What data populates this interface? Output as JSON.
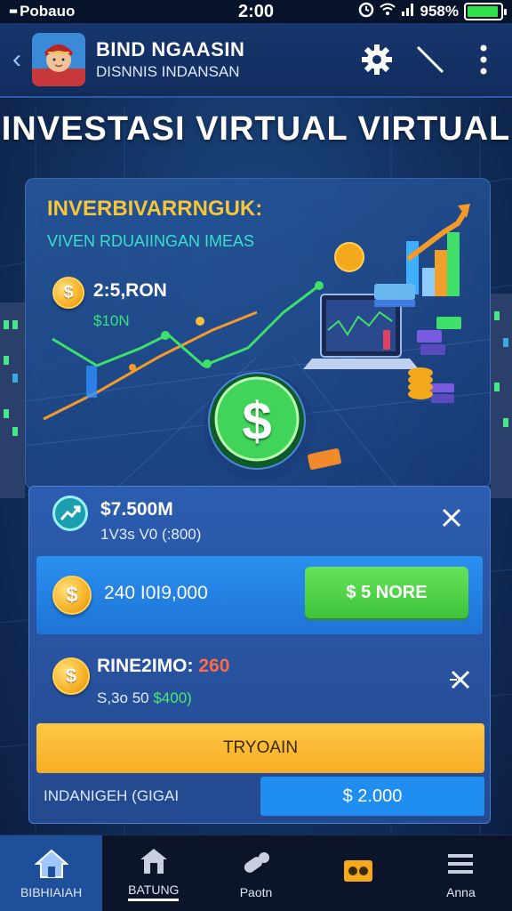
{
  "status_bar": {
    "carrier": "Pobauo",
    "time": "2:00",
    "battery": "958%",
    "battery_level": 0.95
  },
  "header": {
    "back_icon": "chevron-left-icon",
    "title": "BIND NGAASIN",
    "subtitle": "DISNNIS INDANSAN",
    "icons": [
      "gear-icon",
      "slash-icon",
      "more-vertical-icon"
    ]
  },
  "page_title": "INVESTASI VIRTUAL VIRTUAL",
  "hero": {
    "title": "INVERBIVARRNGUK:",
    "subtitle": "VIVEN RDUAIINGAN IMEAS",
    "coin_symbol": "$",
    "amount": "2:5,RON",
    "amount_sub": "$10N",
    "big_coin_symbol": "$"
  },
  "panel": {
    "row1": {
      "value": "$7.500M",
      "sub": "1V3s V0 (:800)"
    },
    "row2": {
      "coin_symbol": "$",
      "value": "240 I0I9,000",
      "button": "$ 5 NORE"
    },
    "row3": {
      "coin_symbol": "$",
      "value_prefix": "RINE2IMO:",
      "value_highlight": "260",
      "sub_prefix": "S,3o 50",
      "sub_green": "$400)"
    },
    "yellow_button": "TRYOAIN",
    "footer_label": "INDANIGEH (GIGAI",
    "footer_value": "$ 2.000"
  },
  "bottom_nav": [
    {
      "label": "BIBHIAIAH",
      "icon": "home-icon",
      "active": true
    },
    {
      "label": "BATUNG",
      "icon": "house-icon",
      "active": false
    },
    {
      "label": "Paotn",
      "icon": "pills-icon",
      "active": false
    },
    {
      "label": "",
      "icon": "ticket-icon",
      "active": false
    },
    {
      "label": "Anna",
      "icon": "menu-icon",
      "active": false
    }
  ],
  "colors": {
    "accent_yellow": "#f7c638",
    "accent_green": "#3fc33a",
    "primary_blue": "#1e74d6",
    "background": "#143465"
  }
}
